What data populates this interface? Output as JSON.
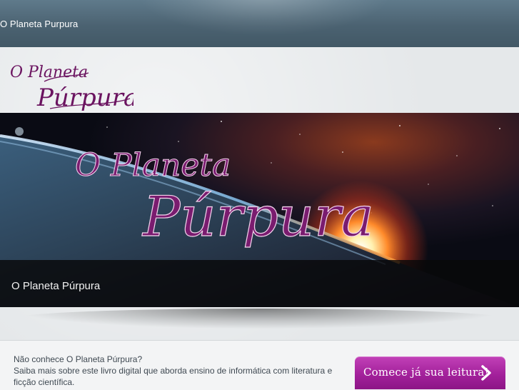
{
  "header": {
    "site_title": "O Planeta Purpura"
  },
  "logo": {
    "line1": "O Planeta",
    "line2": "Púrpura"
  },
  "banner": {
    "title_line1": "O Planeta",
    "title_line2": "Púrpura",
    "caption": "O Planeta Púrpura"
  },
  "promo": {
    "line1": "Não conhece O Planeta Púrpura?",
    "line2": "Saiba mais sobre este livro digital que aborda ensino de informática com literatura e ficção científica.",
    "cta_label": "Comece já sua leitura!",
    "cta_icon": "chevron-right-icon"
  },
  "colors": {
    "topbar": "#4b6271",
    "accent_purple": "#a3219b",
    "logo_purple": "#6b1460",
    "text": "#3f4952"
  }
}
